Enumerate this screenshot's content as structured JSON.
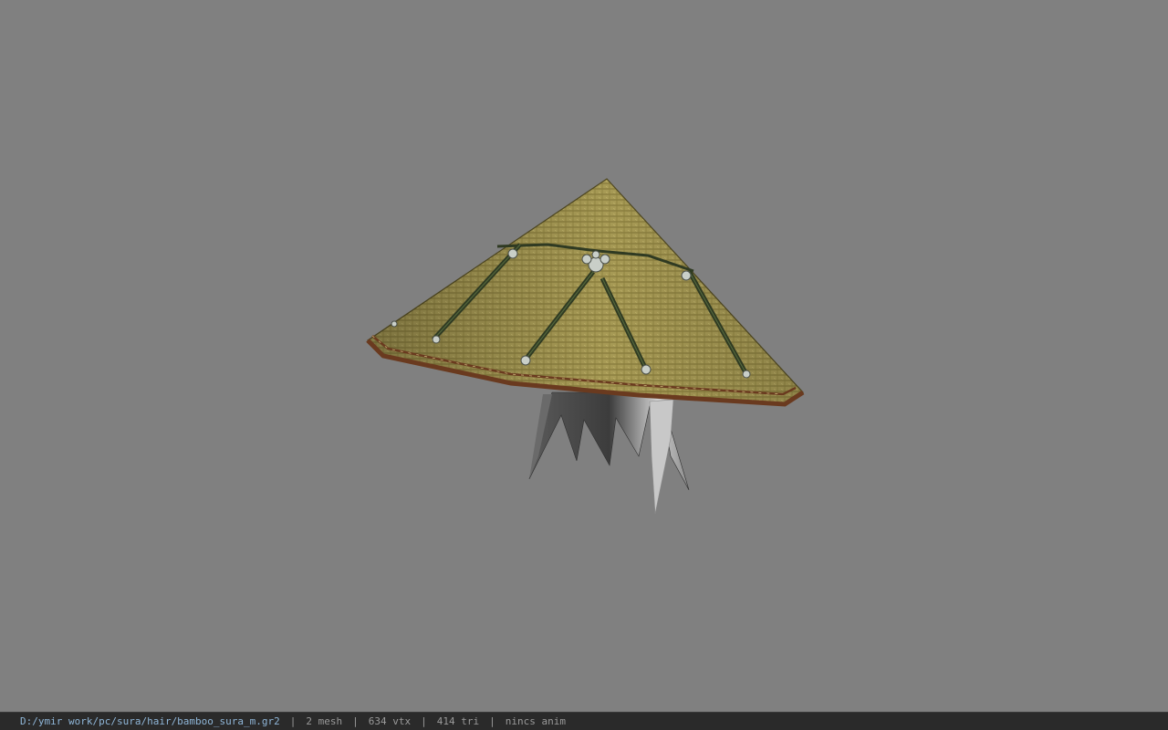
{
  "viewport": {
    "background": "#808080",
    "model": {
      "hat_icon": "conical-bamboo-hat",
      "hair_icon": "hair-strands",
      "colors": {
        "straw_light": "#a79a55",
        "straw_dark": "#6b6130",
        "band": "#6a3a1f",
        "strap": "#2f3a22",
        "knot": "#c9cfc8",
        "hair_dark": "#3c3c3c",
        "hair_light": "#d0d0d0"
      }
    }
  },
  "status_bar": {
    "file_path": "D:/ymir work/pc/sura/hair/bamboo_sura_m.gr2",
    "separator": "|",
    "mesh_count": "2 mesh",
    "vertex_count": "634 vtx",
    "triangle_count": "414 tri",
    "anim_status": "nincs anim",
    "path_color": "#8fb6d8",
    "text_color": "#9a9a9a"
  }
}
